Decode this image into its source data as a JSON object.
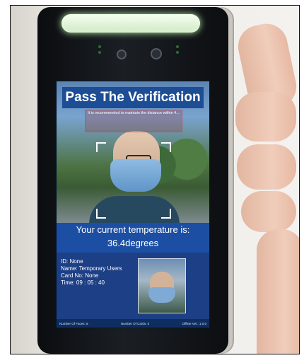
{
  "screen": {
    "title": "Pass The Verification",
    "hint": "It is recommended to maintain the distance within 4...",
    "temperature_label": "Your current temperature is:",
    "temperature_value": "36.4degrees",
    "info": {
      "id": "ID: None",
      "name": "Name: Temporary Users",
      "card": "Card No: None",
      "time": "Time: 09 : 05 : 40"
    },
    "status_bar": {
      "faces": "Number Of Faces: 6",
      "cards": "Number Of Cards: 0",
      "offline": "Offline Ver.: 1.0.0"
    }
  },
  "colors": {
    "banner": "#1c4d95",
    "temp_bar": "#1c4fa3",
    "info_panel": "#1d3f86",
    "light_bar": "#cfe9c4",
    "device_body": "#111418"
  },
  "icons": [
    "camera-lens-icon",
    "ir-sensor-icon"
  ]
}
